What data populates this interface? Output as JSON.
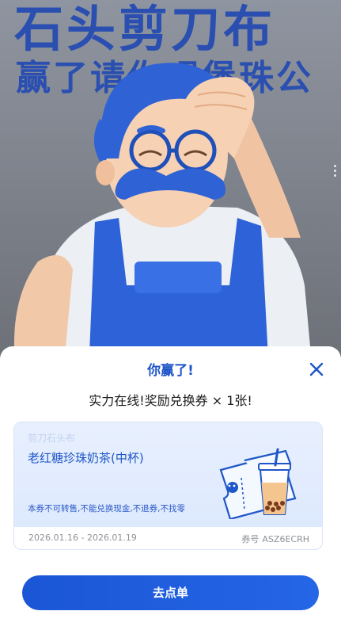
{
  "poster": {
    "title_line1": "石头剪刀布",
    "title_line2": "赢了请你喝堡珠公"
  },
  "modal": {
    "title": "你赢了!",
    "subtitle": "实力在线!奖励兑换券 × 1张!",
    "close_icon": "close-icon"
  },
  "coupon": {
    "brand": "剪刀石头布",
    "name": "老红糖珍珠奶茶(中杯)",
    "note": "本券不可转售,不能兑换现金,不退券,不找零",
    "date_range": "2026.01.16 - 2026.01.19",
    "code_label": "券号",
    "code_value": "ASZ6ECRH"
  },
  "actions": {
    "order_label": "去点单"
  },
  "colors": {
    "accent": "#1f56c8",
    "button": "#1a56d6",
    "coupon_bg": "#e4edfd"
  }
}
